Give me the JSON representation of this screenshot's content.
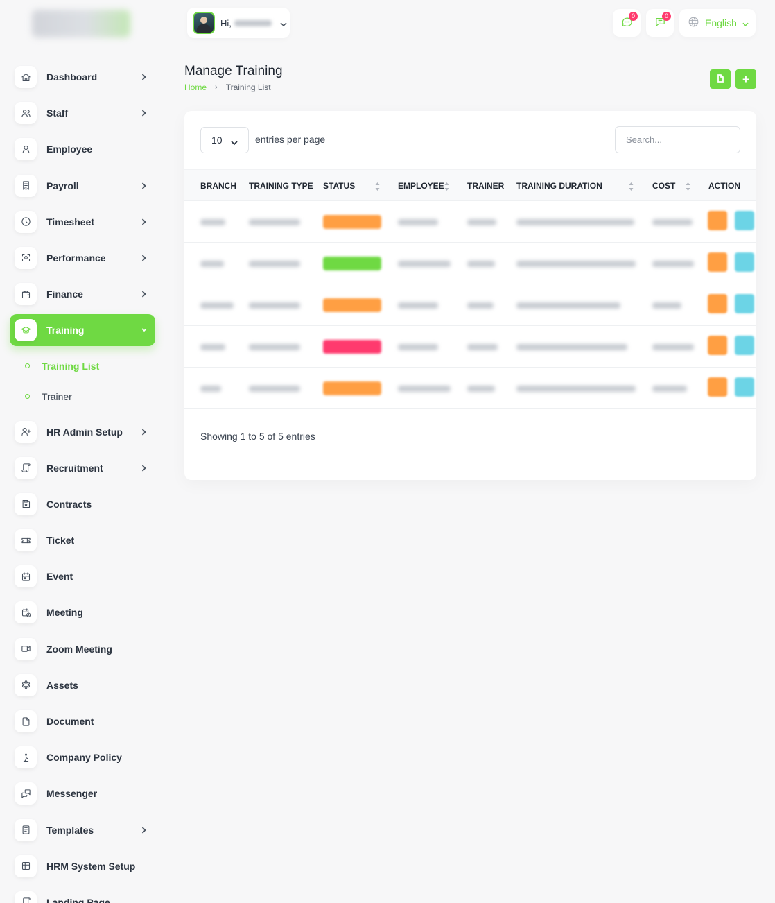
{
  "header": {
    "greeting": "Hi,",
    "notif_count": "0",
    "messages_count": "0",
    "language": "English"
  },
  "sidebar": {
    "items": [
      {
        "label": "Dashboard",
        "icon": "home-icon",
        "chevron": true
      },
      {
        "label": "Staff",
        "icon": "users-icon",
        "chevron": true
      },
      {
        "label": "Employee",
        "icon": "user-icon",
        "chevron": false
      },
      {
        "label": "Payroll",
        "icon": "receipt-icon",
        "chevron": true
      },
      {
        "label": "Timesheet",
        "icon": "clock-icon",
        "chevron": true
      },
      {
        "label": "Performance",
        "icon": "focus-icon",
        "chevron": true
      },
      {
        "label": "Finance",
        "icon": "wallet-icon",
        "chevron": true
      },
      {
        "label": "Training",
        "icon": "graduation-cap-icon",
        "chevron": true,
        "active": true,
        "submenu": [
          {
            "label": "Training List",
            "current": true
          },
          {
            "label": "Trainer",
            "current": false
          }
        ]
      },
      {
        "label": "HR Admin Setup",
        "icon": "user-plus-icon",
        "chevron": true
      },
      {
        "label": "Recruitment",
        "icon": "license-icon",
        "chevron": true
      },
      {
        "label": "Contracts",
        "icon": "device-floppy-icon",
        "chevron": false
      },
      {
        "label": "Ticket",
        "icon": "ticket-icon",
        "chevron": false
      },
      {
        "label": "Event",
        "icon": "calendar-event-icon",
        "chevron": false
      },
      {
        "label": "Meeting",
        "icon": "calendar-time-icon",
        "chevron": false
      },
      {
        "label": "Zoom Meeting",
        "icon": "video-icon",
        "chevron": false
      },
      {
        "label": "Assets",
        "icon": "medical-cross-icon",
        "chevron": false
      },
      {
        "label": "Document",
        "icon": "file-icon",
        "chevron": false
      },
      {
        "label": "Company Policy",
        "icon": "pray-icon",
        "chevron": false
      },
      {
        "label": "Messenger",
        "icon": "messages-icon",
        "chevron": false
      },
      {
        "label": "Templates",
        "icon": "notes-icon",
        "chevron": true
      },
      {
        "label": "HRM System Setup",
        "icon": "table-icon",
        "chevron": false
      },
      {
        "label": "Landing Page",
        "icon": "license-icon",
        "chevron": false
      }
    ]
  },
  "page": {
    "title": "Manage Training",
    "breadcrumb": {
      "home": "Home",
      "current": "Training List"
    }
  },
  "table": {
    "per_page": "10",
    "per_page_label": "entries per page",
    "search_placeholder": "Search...",
    "columns": [
      "BRANCH",
      "TRAINING TYPE",
      "STATUS",
      "EMPLOYEE",
      "TRAINER",
      "TRAINING DURATION",
      "COST",
      "ACTION"
    ],
    "rows": [
      {
        "status_color": "#ff9f43"
      },
      {
        "status_color": "#6fd943"
      },
      {
        "status_color": "#ff9f43"
      },
      {
        "status_color": "#ff3a6e"
      },
      {
        "status_color": "#ff9f43"
      }
    ],
    "showing": "Showing 1 to 5 of 5 entries"
  },
  "colors": {
    "accent": "#6fd943",
    "danger": "#ff3a6e",
    "warning": "#ff9f43",
    "info": "#6cd4e6"
  }
}
